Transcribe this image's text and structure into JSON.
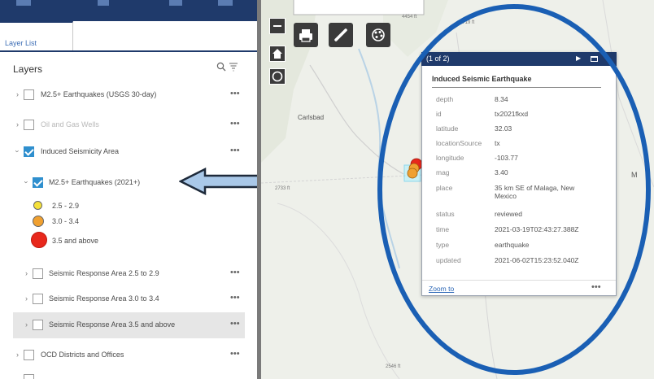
{
  "panel": {
    "tab_label": "Layer List",
    "title": "Layers",
    "icons": [
      "search-icon",
      "filter-icon",
      "more-options-icon",
      "expand-chevron-icon"
    ]
  },
  "layers": [
    {
      "label": "M2.5+ Earthquakes (USGS 30-day)",
      "checked": false,
      "faded": false,
      "more": "•••"
    },
    {
      "label": "Oil and Gas Wells",
      "checked": false,
      "faded": true,
      "more": "•••"
    },
    {
      "label": "Induced Seismicity Area",
      "checked": true,
      "faded": false,
      "more": "•••"
    },
    {
      "label": "M2.5+ Earthquakes (2021+)",
      "checked": true,
      "faded": false,
      "more": ""
    },
    {
      "label": "Seismic Response Area 2.5 to 2.9",
      "checked": false,
      "faded": false,
      "more": "•••"
    },
    {
      "label": "Seismic Response Area 3.0 to 3.4",
      "checked": false,
      "faded": false,
      "more": "•••"
    },
    {
      "label": "Seismic Response Area 3.5 and above",
      "checked": false,
      "faded": false,
      "more": "•••"
    },
    {
      "label": "OCD Districts and Offices",
      "checked": false,
      "faded": false,
      "more": "•••"
    }
  ],
  "legend": [
    {
      "label": "2.5 - 2.9",
      "color": "#f5e13a"
    },
    {
      "label": "3.0 - 3.4",
      "color": "#f0a030"
    },
    {
      "label": "3.5 and above",
      "color": "#e8281c"
    }
  ],
  "map": {
    "place_label": "Carlsbad",
    "edge_label": "M",
    "elevations": [
      "4454 ft",
      "3719 ft",
      "2733 ft",
      "2546 ft"
    ],
    "controls": [
      "zoom-out-icon",
      "home-icon",
      "compass-icon"
    ],
    "tools": [
      "print-icon",
      "draw-icon",
      "basemap-icon"
    ]
  },
  "popup": {
    "count": "(1 of 2)",
    "title": "Induced Seismic Earthquake",
    "fields": [
      {
        "key": "depth",
        "value": "8.34"
      },
      {
        "key": "id",
        "value": "tx2021fkxd"
      },
      {
        "key": "latitude",
        "value": "32.03"
      },
      {
        "key": "locationSource",
        "value": "tx"
      },
      {
        "key": "longitude",
        "value": "-103.77"
      },
      {
        "key": "mag",
        "value": "3.40"
      },
      {
        "key": "place",
        "value": "35 km SE of Malaga, New\nMexico"
      },
      {
        "key": "status",
        "value": "reviewed"
      },
      {
        "key": "time",
        "value": "2021-03-19T02:43:27.388Z"
      },
      {
        "key": "type",
        "value": "earthquake"
      },
      {
        "key": "updated",
        "value": "2021-06-02T15:23:52.040Z"
      }
    ],
    "zoom_label": "Zoom to",
    "more": "•••"
  },
  "colors": {
    "header": "#1f3a6b",
    "accent": "#2f8fce",
    "annotation": "#1a5fb4",
    "arrow_fill": "#a9c8e8"
  }
}
